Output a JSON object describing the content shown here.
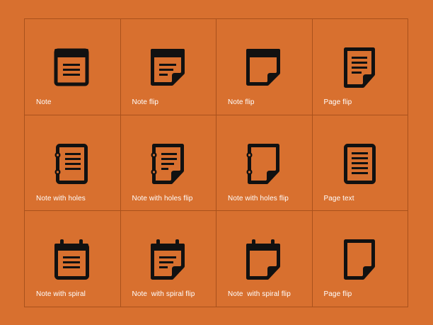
{
  "colors": {
    "background": "#d8702f",
    "grid_line": "#a9511c",
    "icon": "#111111",
    "label": "#ffffff"
  },
  "cells": [
    {
      "label": "Note",
      "icon": "note-icon"
    },
    {
      "label": "Note flip",
      "icon": "note-flip-icon"
    },
    {
      "label": "Note flip",
      "icon": "note-flip-icon"
    },
    {
      "label": "Page flip",
      "icon": "page-flip-icon"
    },
    {
      "label": "Note with holes",
      "icon": "note-with-holes-icon"
    },
    {
      "label": "Note with holes flip",
      "icon": "note-with-holes-flip-icon"
    },
    {
      "label": "Note with holes flip",
      "icon": "note-with-holes-flip-icon"
    },
    {
      "label": "Page text",
      "icon": "page-text-icon"
    },
    {
      "label": "Note with spiral",
      "icon": "note-with-spiral-icon"
    },
    {
      "label": "Note  with spiral flip",
      "icon": "note-with-spiral-flip-icon"
    },
    {
      "label": "Note  with spiral flip",
      "icon": "note-with-spiral-flip-icon"
    },
    {
      "label": "Page flip",
      "icon": "page-flip-icon"
    }
  ]
}
